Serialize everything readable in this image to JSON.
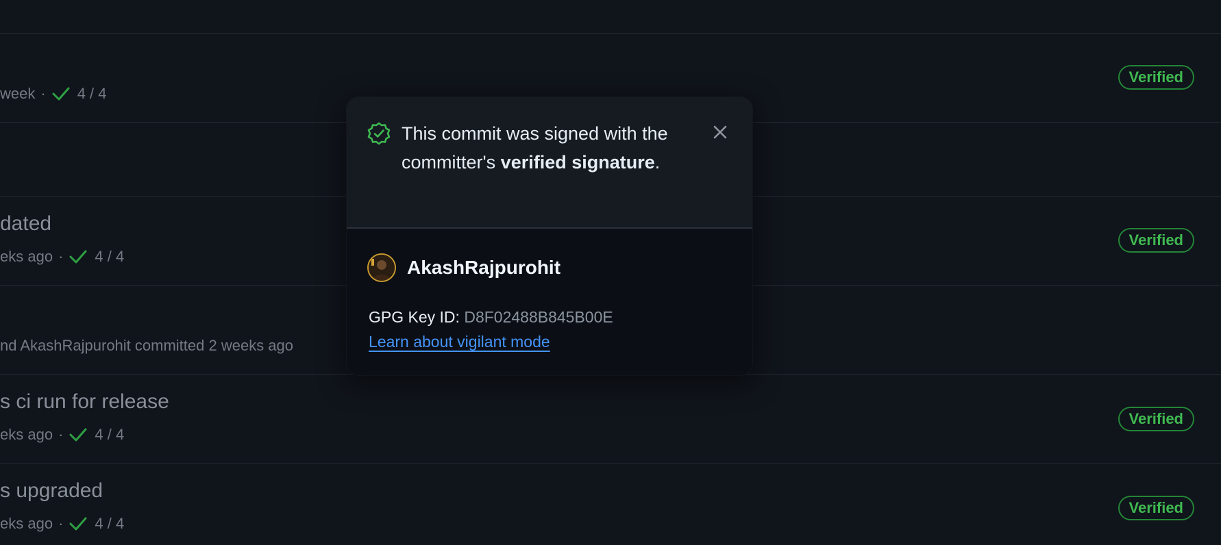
{
  "rows": [
    {
      "title": "",
      "meta_left": "week",
      "checks": "4 / 4",
      "verified": "Verified"
    },
    {
      "title": "",
      "meta_left": "",
      "checks": "",
      "verified": ""
    },
    {
      "title": "dated",
      "meta_left": "eks ago",
      "checks": "4 / 4",
      "verified": "Verified"
    },
    {
      "title": "",
      "meta_left": "nd AkashRajpurohit committed 2 weeks ago",
      "checks": "",
      "verified": ""
    },
    {
      "title": "s ci run for release",
      "meta_left": "eks ago",
      "checks": "4 / 4",
      "verified": "Verified"
    },
    {
      "title": "s upgraded",
      "meta_left": "eks ago",
      "checks": "4 / 4",
      "verified": "Verified"
    }
  ],
  "popover": {
    "message_part1": "This commit was signed with the committer's ",
    "message_bold": "verified signature",
    "message_end": ".",
    "username": "AkashRajpurohit",
    "gpg_label": "GPG Key ID: ",
    "gpg_key": "D8F02488B845B00E",
    "link_text": "Learn about vigilant mode"
  },
  "icons": {
    "shield": "verified-shield-icon",
    "close": "close-icon",
    "check": "check-icon"
  },
  "colors": {
    "background": "#10141b",
    "verified_green": "#3fb950",
    "link_blue": "#4493f8"
  }
}
